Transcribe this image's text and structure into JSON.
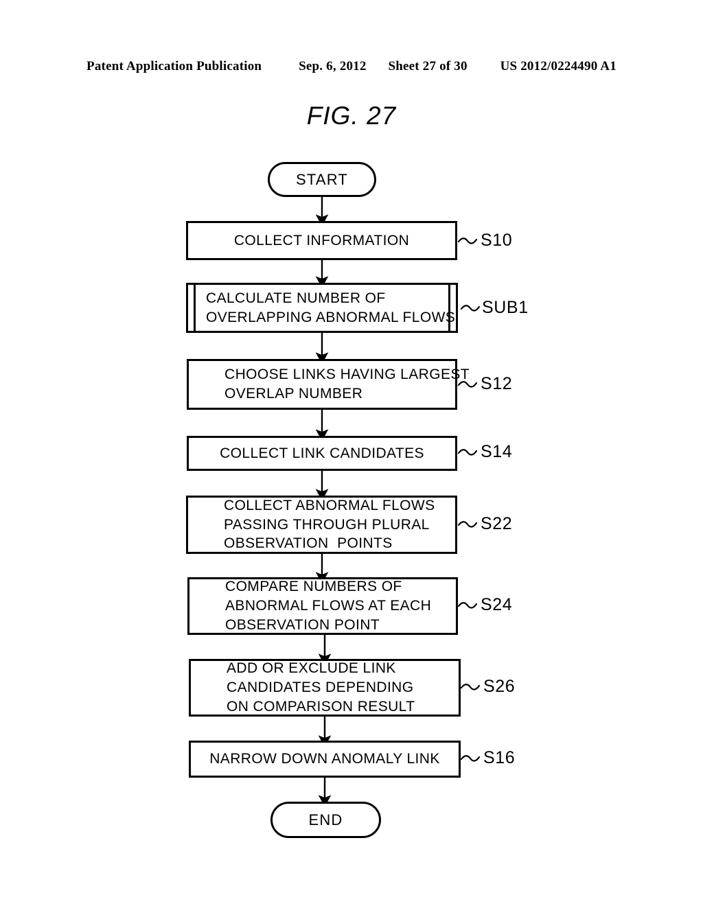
{
  "header": {
    "publication": "Patent Application Publication",
    "date": "Sep. 6, 2012",
    "sheet": "Sheet 27 of 30",
    "patent_number": "US 2012/0224490 A1"
  },
  "figure": {
    "title": "FIG. 27"
  },
  "flowchart": {
    "start": {
      "label": "START"
    },
    "end": {
      "label": "END"
    },
    "steps": [
      {
        "id": "s10",
        "ref": "S10",
        "shape": "process",
        "align": "center",
        "lines": [
          "COLLECT INFORMATION"
        ]
      },
      {
        "id": "sub1",
        "ref": "SUB1",
        "shape": "subroutine",
        "align": "left",
        "lines": [
          "CALCULATE NUMBER OF",
          "OVERLAPPING ABNORMAL FLOWS"
        ]
      },
      {
        "id": "s12",
        "ref": "S12",
        "shape": "process",
        "align": "indent",
        "lines": [
          "CHOOSE LINKS HAVING LARGEST",
          "OVERLAP NUMBER"
        ]
      },
      {
        "id": "s14",
        "ref": "S14",
        "shape": "process",
        "align": "center",
        "lines": [
          "COLLECT LINK CANDIDATES"
        ]
      },
      {
        "id": "s22",
        "ref": "S22",
        "shape": "process",
        "align": "indent",
        "lines": [
          "COLLECT ABNORMAL FLOWS",
          "PASSING THROUGH PLURAL",
          "OBSERVATION  POINTS"
        ]
      },
      {
        "id": "s24",
        "ref": "S24",
        "shape": "process",
        "align": "indent",
        "lines": [
          "COMPARE NUMBERS OF",
          "ABNORMAL FLOWS AT EACH",
          "OBSERVATION POINT"
        ]
      },
      {
        "id": "s26",
        "ref": "S26",
        "shape": "process",
        "align": "indent",
        "lines": [
          "ADD OR EXCLUDE LINK",
          "CANDIDATES DEPENDING",
          "ON COMPARISON RESULT"
        ]
      },
      {
        "id": "s16",
        "ref": "S16",
        "shape": "process",
        "align": "center",
        "lines": [
          "NARROW DOWN ANOMALY LINK"
        ]
      }
    ]
  },
  "colors": {
    "ink": "#000000",
    "paper": "#ffffff"
  }
}
